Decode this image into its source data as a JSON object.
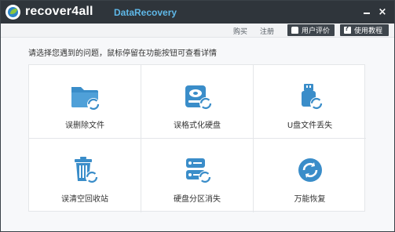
{
  "app": {
    "name": "recover4all",
    "subtitle": "DataRecovery"
  },
  "window_controls": {
    "minimize": "–",
    "close": "×"
  },
  "toolbar": {
    "buy": "购买",
    "register": "注册",
    "review": "用户评价",
    "tutorial": "使用教程"
  },
  "main": {
    "prompt": "请选择您遇到的问题，鼠标停留在功能按钮可查看详情",
    "options": [
      {
        "label": "误删除文件",
        "icon": "folder-recover-icon"
      },
      {
        "label": "误格式化硬盘",
        "icon": "disk-recover-icon"
      },
      {
        "label": "U盘文件丢失",
        "icon": "usb-recover-icon"
      },
      {
        "label": "误清空回收站",
        "icon": "recycle-bin-recover-icon"
      },
      {
        "label": "硬盘分区消失",
        "icon": "partition-recover-icon"
      },
      {
        "label": "万能恢复",
        "icon": "universal-recover-icon"
      }
    ]
  },
  "colors": {
    "titlebar": "#2f353b",
    "accent": "#3a8dc9",
    "subtitle": "#5fb8e8"
  }
}
